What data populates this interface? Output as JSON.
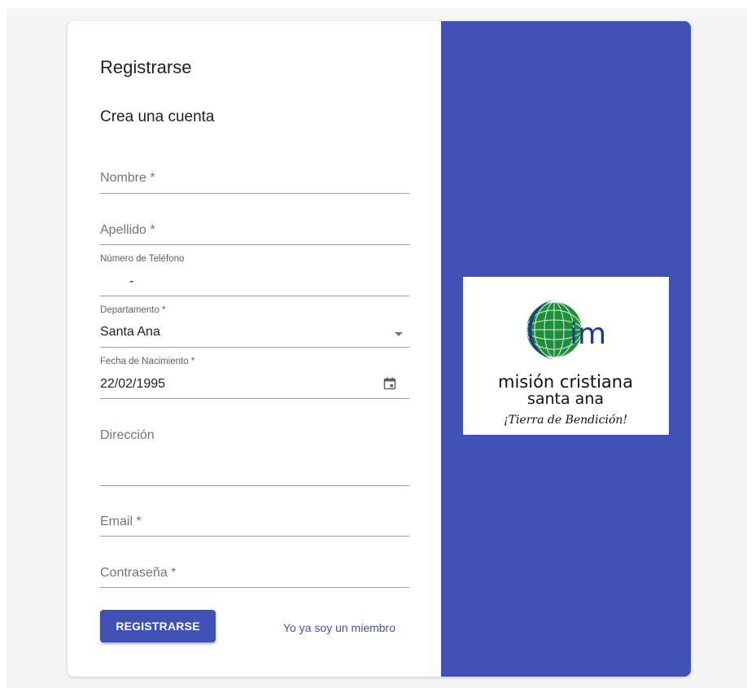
{
  "form": {
    "title": "Registrarse",
    "subtitle": "Crea una cuenta",
    "nombre": {
      "placeholder": "Nombre *",
      "value": ""
    },
    "apellido": {
      "placeholder": "Apellido *",
      "value": ""
    },
    "telefono": {
      "label": "Número de Teléfono",
      "value": "-"
    },
    "departamento": {
      "label": "Departamento *",
      "value": "Santa Ana"
    },
    "fecha": {
      "label": "Fecha de Nacimiento *",
      "value": "22/02/1995"
    },
    "direccion": {
      "placeholder": "Dirección",
      "value": ""
    },
    "email": {
      "placeholder": "Email *",
      "value": ""
    },
    "contrasena": {
      "placeholder": "Contraseña *",
      "value": ""
    },
    "submit_label": "REGISTRARSE",
    "member_link": "Yo ya soy un miembro"
  },
  "brand": {
    "logo_letters": "im",
    "name_line1": "misión cristiana",
    "name_line2": "santa ana",
    "slogan": "¡Tierra de Bendición!",
    "panel_color": "#3f51b5",
    "globe_color": "#1e8f3a",
    "ring_color": "#1a3a8a"
  }
}
